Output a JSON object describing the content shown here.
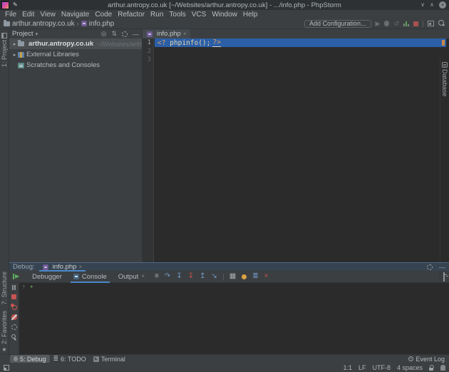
{
  "window": {
    "title": "arthur.antropy.co.uk [~/Websites/arthur.antropy.co.uk] - .../info.php - PhpStorm"
  },
  "icons": {
    "caret_down": "▾",
    "breadcrumb_sep": "›",
    "tree_expand": "▸",
    "run": "▶",
    "rerun": "▶",
    "coverage": "↺",
    "minimize": "∨",
    "maximize": "∧",
    "close": "×",
    "locate": "◎",
    "collapse_all": "⇅",
    "hide": "―",
    "show_execution_point": "≡",
    "step_over": "↷",
    "step_into": "↧",
    "force_step_into": "↧",
    "step_out": "↥",
    "run_to_cursor": "↘",
    "evaluate": "▦",
    "layout": "≣",
    "close_red": "×",
    "scroll_to_top": "↑",
    "console_prompt": "▸",
    "todo": "≣",
    "pin": "✎",
    "star": "★"
  },
  "menu": {
    "items": [
      "File",
      "Edit",
      "View",
      "Navigate",
      "Code",
      "Refactor",
      "Run",
      "Tools",
      "VCS",
      "Window",
      "Help"
    ]
  },
  "navbar": {
    "project_crumb": "arthur.antropy.co.uk",
    "file_crumb": "info.php",
    "add_configuration": "Add Configuration..."
  },
  "stripes": {
    "project": "1: Project",
    "structure": "7: Structure",
    "favorites": "2: Favorites",
    "database": "Database"
  },
  "project_panel": {
    "header": "Project",
    "root_name": "arthur.antropy.co.uk",
    "root_path": "~/Websites/arthur.antropy.co.uk",
    "external_libraries": "External Libraries",
    "scratches": "Scratches and Consoles"
  },
  "editor": {
    "tab": "info.php",
    "line_numbers": [
      "1",
      "2",
      "3"
    ],
    "code": {
      "open_tag": "<?",
      "body": " phpinfo();",
      "close_tag": "?>"
    }
  },
  "debug": {
    "label": "Debug:",
    "session_tab": "info.php",
    "tabs": {
      "debugger": "Debugger",
      "console": "Console",
      "output": "Output"
    }
  },
  "tool_buttons": {
    "debug": "5: Debug",
    "todo": "6: TODO",
    "terminal": "Terminal",
    "event_log": "Event Log"
  },
  "status": {
    "caret": "1:1",
    "line_separator": "LF",
    "encoding": "UTF-8",
    "indent": "4 spaces"
  },
  "colors": {
    "selection_line": "#2b5fa8",
    "tab_underline": "#4a88c7",
    "stop_red": "#c75450",
    "run_green": "#5fad5f",
    "breakpoint_orange": "#d9a343",
    "editor_bg": "#2b2b2b",
    "panel_bg": "#3c3f41"
  }
}
